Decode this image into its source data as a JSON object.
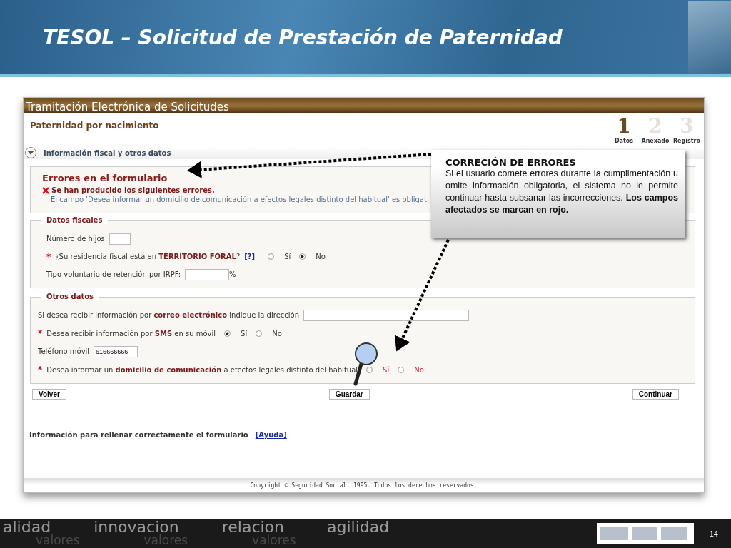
{
  "slide": {
    "title": "TESOL – Solicitud de Prestación de Paternidad",
    "page_number": "14",
    "footer_words": [
      "alidad",
      "innovacion",
      "relacion",
      "agilidad"
    ],
    "footer_words_2": [
      "valores",
      "valores",
      "valores"
    ]
  },
  "app": {
    "banner": "Tramitación Electrónica de Solicitudes",
    "heading": "Paternidad por nacimiento",
    "steps": [
      {
        "number": "1",
        "label": "Datos",
        "selected": true
      },
      {
        "number": "2",
        "label": "Anexado",
        "selected": false
      },
      {
        "number": "3",
        "label": "Registro",
        "selected": false
      }
    ],
    "section": {
      "label": "Información fiscal y otros datos",
      "expanded": true
    },
    "errors": {
      "title": "Errores en el formulario",
      "heading": "Se han producido los siguientes errores.",
      "message": "El campo 'Desea informar un domicilio de comunicación a efectos legales distinto del habitual' es obligat"
    },
    "fieldsets": [
      {
        "legend": "Datos fiscales",
        "rows": [
          {
            "kind": "input",
            "label": "Número de hijos"
          },
          {
            "kind": "radio",
            "required_mark": "*",
            "label": "¿Su residencia fiscal está en **TERRITORIO FORAL**?",
            "help": "[?]",
            "error": false,
            "options": [
              {
                "label": "Sí",
                "selected": false
              },
              {
                "label": "No",
                "selected": true
              }
            ]
          },
          {
            "kind": "input",
            "label": "Tipo voluntario de retención por IRPF:",
            "suffix": "%"
          }
        ]
      },
      {
        "legend": "Otros datos",
        "rows": [
          {
            "kind": "input",
            "label": "Si desea recibir información por **correo electrónico** indique la dirección"
          },
          {
            "kind": "radio",
            "required_mark": "*",
            "label": "Desea recibir información por **SMS** en su móvil",
            "error": false,
            "options": [
              {
                "label": "Sí",
                "selected": true
              },
              {
                "label": "No",
                "selected": false
              }
            ]
          },
          {
            "kind": "input",
            "label": "Teléfono móvil",
            "value": "616666666"
          },
          {
            "kind": "radio",
            "required_mark": "*",
            "label": "Desea informar un **domicilio de comunicación** a efectos legales distinto del habitual",
            "error": true,
            "options": [
              {
                "label": "Sí",
                "selected": false
              },
              {
                "label": "No",
                "selected": false
              }
            ]
          }
        ]
      }
    ],
    "buttons": [
      {
        "label": "Volver"
      },
      {
        "label": "Guardar"
      },
      {
        "label": "Continuar"
      }
    ],
    "help": {
      "text": "Información para rellenar correctamente el formulario",
      "link": "[Ayuda]"
    },
    "copyright": "Copyright © Seguridad Social. 1995. Todos los derechos reservados."
  },
  "callout": {
    "title": "CORRECIÓN DE ERRORES",
    "text": "Si el usuario comete errores durante la cumplimentación u omite información obligatoria, el sistema no le permite continuar hasta subsanar las incorrecciones. **Los campos afectados se marcan en rojo.**"
  }
}
